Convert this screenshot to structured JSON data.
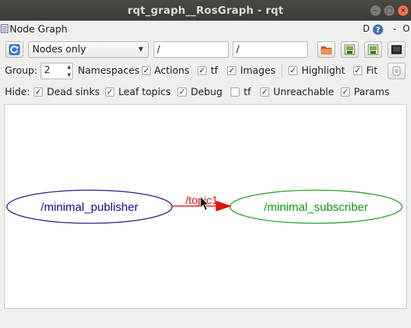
{
  "window": {
    "title": "rqt_graph__RosGraph - rqt",
    "controls": [
      "minimize",
      "maximize",
      "close"
    ]
  },
  "plugin": {
    "title": "Node Graph",
    "help_label": "D",
    "close_label": "O"
  },
  "toolbar": {
    "refresh_icon": "refresh-icon",
    "graph_mode": "Nodes only",
    "node_filter": "/",
    "topic_filter": "/",
    "icons": [
      "open-folder-icon",
      "save-image-icon",
      "save-image-icon",
      "screenshot-icon"
    ]
  },
  "options": {
    "group_label": "Group:",
    "group_value": "2",
    "namespaces_label": "Namespaces",
    "actions_label": "Actions",
    "actions_checked": true,
    "tf_label": "tf",
    "tf_checked": true,
    "images_label": "Images",
    "images_checked": true,
    "highlight_label": "Highlight",
    "highlight_checked": true,
    "fit_label": "Fit",
    "fit_checked": true,
    "namespaces_checked": true
  },
  "hide": {
    "label": "Hide:",
    "items": [
      {
        "label": "Dead sinks",
        "checked": true
      },
      {
        "label": "Leaf topics",
        "checked": true
      },
      {
        "label": "Debug",
        "checked": true
      },
      {
        "label": "tf",
        "checked": false
      },
      {
        "label": "Unreachable",
        "checked": true
      },
      {
        "label": "Params",
        "checked": true
      }
    ]
  },
  "graph": {
    "nodes": [
      {
        "name": "/minimal_publisher",
        "color": "#0b0b8a"
      },
      {
        "name": "/minimal_subscriber",
        "color": "#0f9b0f"
      }
    ],
    "edge": {
      "label": "/topic1",
      "color": "#e01010"
    }
  },
  "colors": {
    "titlebar": "#3c3b37",
    "publisher": "#0b0b8a",
    "subscriber": "#0f9b0f",
    "edge": "#e01010"
  }
}
